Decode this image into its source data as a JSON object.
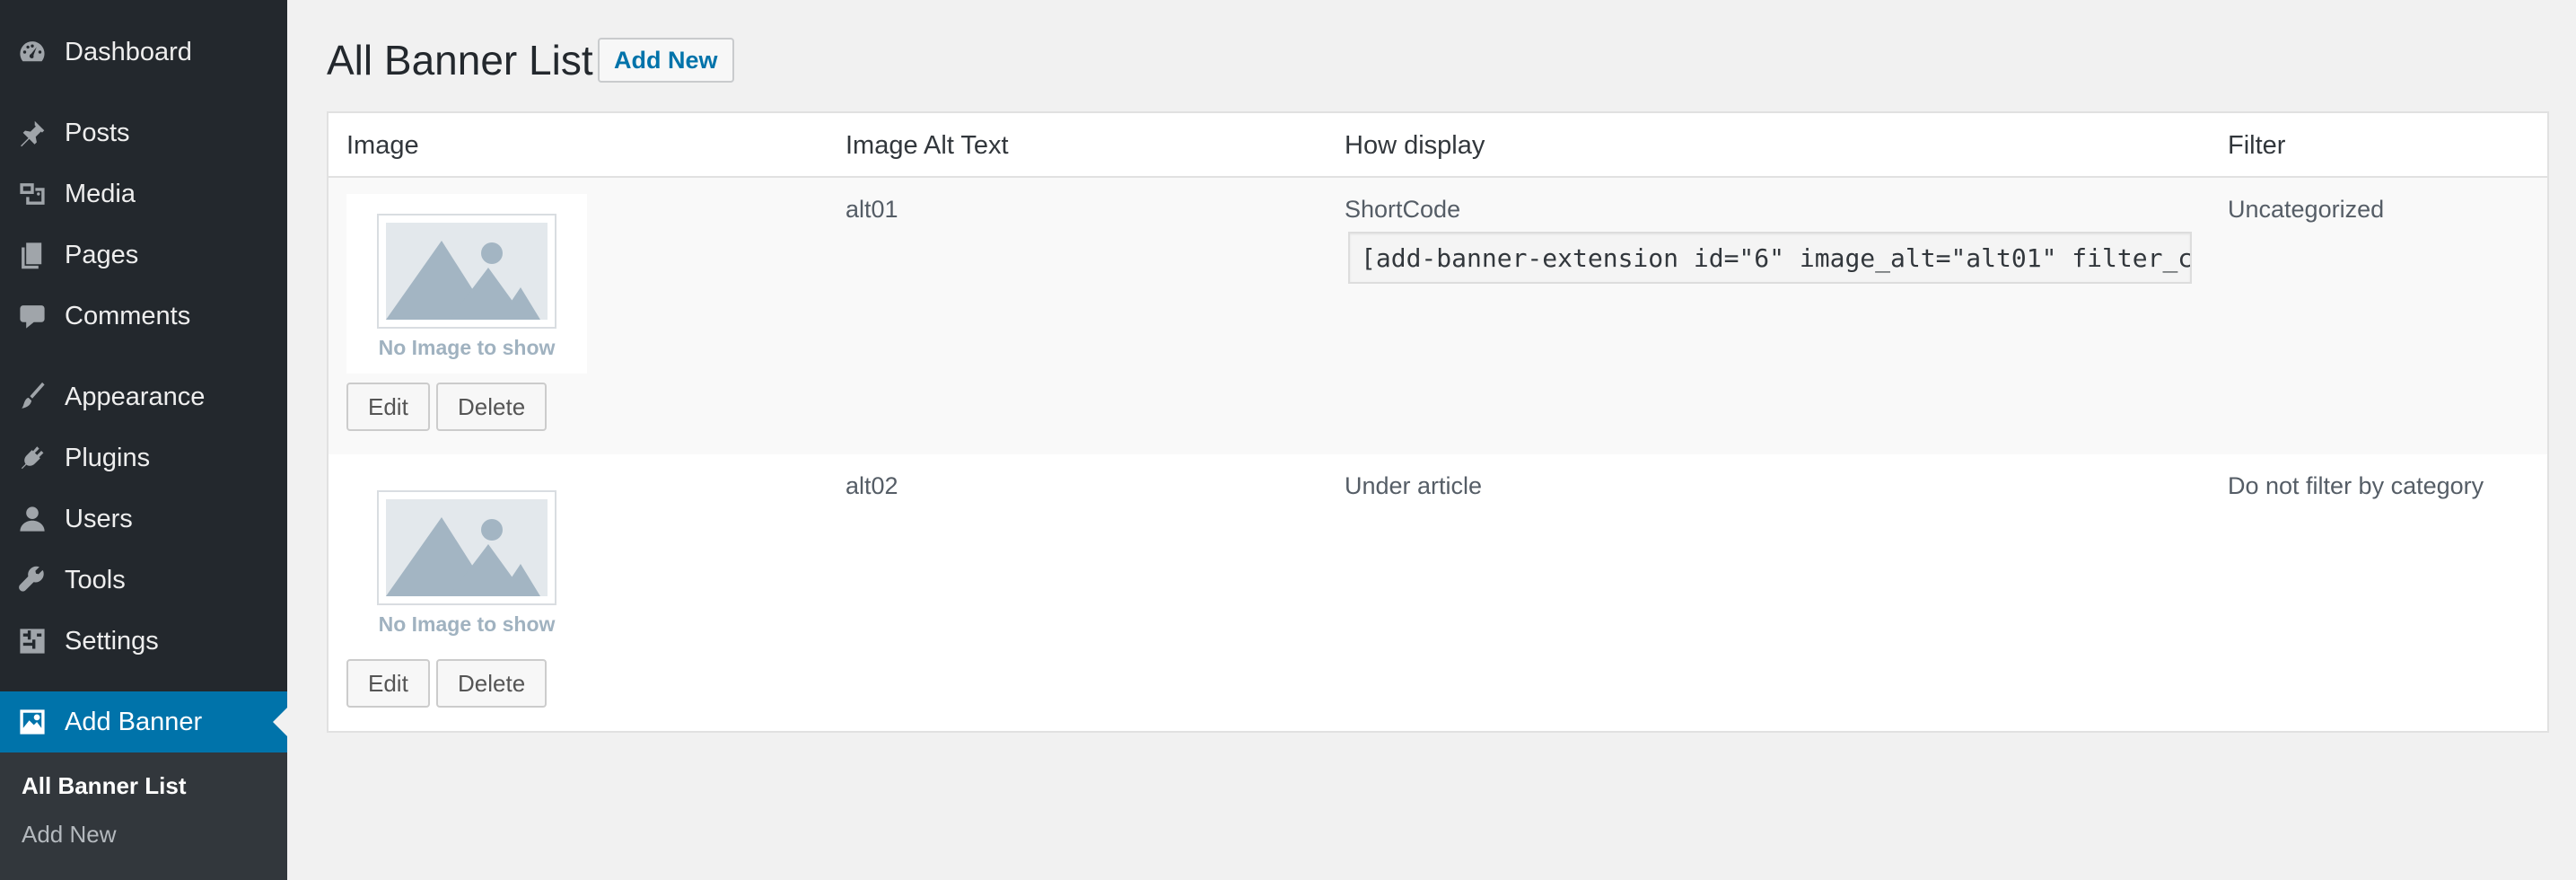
{
  "sidebar": {
    "items": [
      {
        "label": "Dashboard",
        "icon": "dashboard-icon"
      },
      {
        "label": "Posts",
        "icon": "pushpin-icon"
      },
      {
        "label": "Media",
        "icon": "media-icon"
      },
      {
        "label": "Pages",
        "icon": "pages-icon"
      },
      {
        "label": "Comments",
        "icon": "comment-icon"
      },
      {
        "label": "Appearance",
        "icon": "paintbrush-icon"
      },
      {
        "label": "Plugins",
        "icon": "plugin-icon"
      },
      {
        "label": "Users",
        "icon": "user-icon"
      },
      {
        "label": "Tools",
        "icon": "wrench-icon"
      },
      {
        "label": "Settings",
        "icon": "settings-sliders-icon"
      },
      {
        "label": "Add Banner",
        "icon": "banner-image-icon"
      }
    ],
    "submenu": [
      "All Banner List",
      "Add New"
    ],
    "current_item": "Add Banner",
    "current_subitem": "All Banner List"
  },
  "page": {
    "title": "All Banner List",
    "add_new_label": "Add New"
  },
  "table": {
    "columns": [
      "Image",
      "Image Alt Text",
      "How display",
      "Filter"
    ],
    "rows": [
      {
        "image_caption": "No Image to show",
        "alt_text": "alt01",
        "how_display": "ShortCode",
        "shortcode": "[add-banner-extension id=\"6\" image_alt=\"alt01\" filter_c",
        "filter": "Uncategorized",
        "edit_label": "Edit",
        "delete_label": "Delete"
      },
      {
        "image_caption": "No Image to show",
        "alt_text": "alt02",
        "how_display": "Under article",
        "filter": "Do not filter by category",
        "edit_label": "Edit",
        "delete_label": "Delete"
      }
    ]
  },
  "colors": {
    "sidebar_bg": "#23282d",
    "submenu_bg": "#32373c",
    "accent": "#0073aa",
    "page_bg": "#f1f1f1"
  }
}
